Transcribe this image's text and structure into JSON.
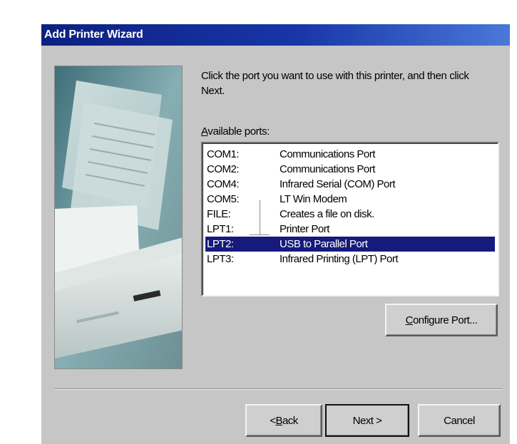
{
  "window": {
    "title": "Add Printer Wizard"
  },
  "illustration": {
    "icon": "printer-with-paper"
  },
  "instructions": "Click the port you want to use with this printer, and then click Next.",
  "ports_label": {
    "mnemonic": "A",
    "rest": "vailable ports:"
  },
  "ports": [
    {
      "name": "COM1:",
      "description": "Communications Port"
    },
    {
      "name": "COM2:",
      "description": "Communications Port"
    },
    {
      "name": "COM4:",
      "description": "Infrared Serial (COM) Port"
    },
    {
      "name": "COM5:",
      "description": "LT Win Modem"
    },
    {
      "name": "FILE:",
      "description": "Creates a file on disk."
    },
    {
      "name": "LPT1:",
      "description": "Printer Port"
    },
    {
      "name": "LPT2:",
      "description": "USB to Parallel Port"
    },
    {
      "name": "LPT3:",
      "description": "Infrared Printing (LPT) Port"
    }
  ],
  "selected_port": "LPT2:",
  "buttons": {
    "configure": {
      "mnemonic": "C",
      "rest": "onfigure Port..."
    },
    "back": {
      "prefix": "< ",
      "mnemonic": "B",
      "rest": "ack"
    },
    "next": "Next >",
    "cancel": "Cancel"
  },
  "colors": {
    "title_bar": "#0c2080",
    "selection": "#151a7c",
    "dialog_face": "#c6c6c6"
  }
}
